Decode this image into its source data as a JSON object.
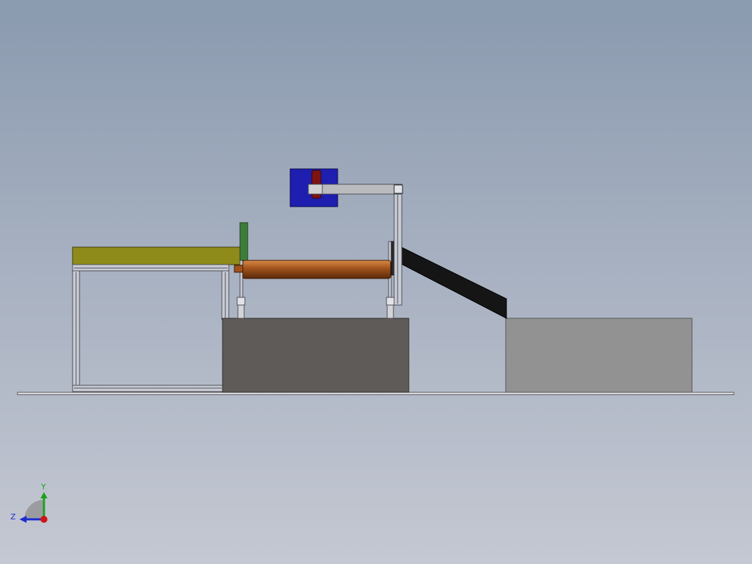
{
  "view": {
    "background_top": "#8a9aaf",
    "background_bottom": "#c4c8d2"
  },
  "colors": {
    "table_top": "#8f8b1b",
    "frame": "#c8cbd3",
    "frame_edge": "#4a4d55",
    "roller": "#a0521b",
    "green_plate": "#3d7d3a",
    "blue_block": "#1e1eb0",
    "red_rod": "#7c1414",
    "arm": "#b9bbbe",
    "chute": "#151515",
    "dark_box": "#5f5b58",
    "light_box": "#929292",
    "floor": "#d9dadd"
  },
  "triad": {
    "y_label": "Y",
    "z_label": "Z",
    "y_color": "#1aa11a",
    "z_color": "#1a2ad0",
    "origin_color": "#d01515"
  }
}
